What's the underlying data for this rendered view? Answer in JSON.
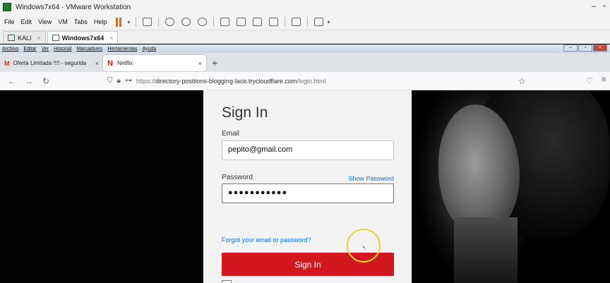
{
  "vmware": {
    "title": "Windows7x64 - VMware Workstation",
    "menu": [
      "File",
      "Edit",
      "View",
      "VM",
      "Tabs",
      "Help"
    ],
    "tabs": [
      {
        "label": "KALI",
        "close": "×"
      },
      {
        "label": "Windows7x64",
        "close": "×"
      }
    ]
  },
  "guest_menu": [
    "Archivo",
    "Editar",
    "Ver",
    "Historial",
    "Marcadores",
    "Herramientas",
    "Ayuda"
  ],
  "browser": {
    "tabs": [
      {
        "label": "Oferta Limitada !!!! - segurida",
        "close": "×"
      },
      {
        "label": "Netflix",
        "close": "×"
      }
    ],
    "new_tab": "+",
    "url": {
      "protocol": "https://",
      "host": "directory-positions-blogging-lace.trycloudflare.com",
      "path": "/login.html"
    }
  },
  "login": {
    "title": "Sign In",
    "email_label": "Email",
    "email_value": "pepito@gmail.com",
    "password_label": "Password",
    "show_password": "Show Password",
    "password_value": "●●●●●●●●●●●",
    "forgot": "Forgot your email or password?",
    "submit": "Sign In"
  },
  "colors": {
    "netflix_red": "#d3171f",
    "link_blue": "#0071eb",
    "pause_orange": "#e36b1c",
    "cursor_ring": "#e8d23a"
  }
}
